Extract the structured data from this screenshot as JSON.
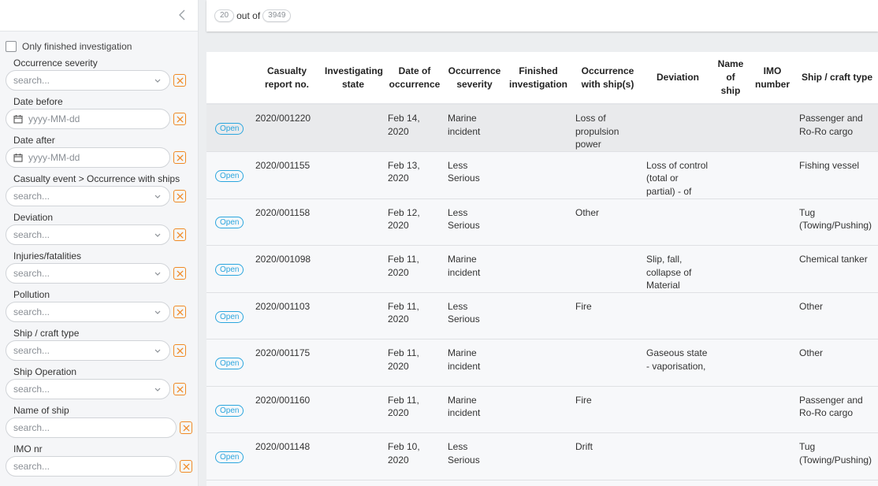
{
  "sidebar": {
    "collapse_icon": "chevron-left-icon",
    "only_finished_label": "Only finished investigation",
    "only_finished_checked": false,
    "filters": [
      {
        "label": "Occurrence severity",
        "type": "select",
        "placeholder": "search..."
      },
      {
        "label": "Date before",
        "type": "date",
        "placeholder": "yyyy-MM-dd"
      },
      {
        "label": "Date after",
        "type": "date",
        "placeholder": "yyyy-MM-dd"
      },
      {
        "label": "Casualty event > Occurrence with ships",
        "type": "select",
        "placeholder": "search..."
      },
      {
        "label": "Deviation",
        "type": "select",
        "placeholder": "search..."
      },
      {
        "label": "Injuries/fatalities",
        "type": "select",
        "placeholder": "search..."
      },
      {
        "label": "Pollution",
        "type": "select",
        "placeholder": "search..."
      },
      {
        "label": "Ship / craft type",
        "type": "select",
        "placeholder": "search..."
      },
      {
        "label": "Ship Operation",
        "type": "select",
        "placeholder": "search..."
      },
      {
        "label": "Name of ship",
        "type": "text",
        "placeholder": "search..."
      },
      {
        "label": "IMO nr",
        "type": "text",
        "placeholder": "search..."
      }
    ]
  },
  "topbar": {
    "shown_count": "20",
    "out_of_label": "out of",
    "total_count": "3949"
  },
  "table": {
    "columns": [
      "",
      "Casualty report no.",
      "Investigating state",
      "Date of occurrence",
      "Occurrence severity",
      "Finished investigation",
      "Occurrence with ship(s)",
      "Deviation",
      "Name of ship",
      "IMO number",
      "Ship / craft type"
    ],
    "rows": [
      {
        "status": "Open",
        "report_no": "2020/001220",
        "investigating_state": "",
        "date": "Feb 14, 2020",
        "severity": "Marine incident",
        "finished": "",
        "occurrence": "Loss of propulsion power",
        "deviation": "",
        "ship_name": "",
        "imo": "",
        "ship_type": "Passenger and Ro-Ro cargo",
        "selected": true
      },
      {
        "status": "Open",
        "report_no": "2020/001155",
        "investigating_state": "",
        "date": "Feb 13, 2020",
        "severity": "Less Serious",
        "finished": "",
        "occurrence": "",
        "deviation": "Loss of control (total or partial) - of",
        "ship_name": "",
        "imo": "",
        "ship_type": "Fishing vessel",
        "selected": false
      },
      {
        "status": "Open",
        "report_no": "2020/001158",
        "investigating_state": "",
        "date": "Feb 12, 2020",
        "severity": "Less Serious",
        "finished": "",
        "occurrence": "Other",
        "deviation": "",
        "ship_name": "",
        "imo": "",
        "ship_type": "Tug (Towing/Pushing)",
        "selected": false
      },
      {
        "status": "Open",
        "report_no": "2020/001098",
        "investigating_state": "",
        "date": "Feb 11, 2020",
        "severity": "Marine incident",
        "finished": "",
        "occurrence": "",
        "deviation": "Slip, fall, collapse of Material",
        "ship_name": "",
        "imo": "",
        "ship_type": "Chemical tanker",
        "selected": false
      },
      {
        "status": "Open",
        "report_no": "2020/001103",
        "investigating_state": "",
        "date": "Feb 11, 2020",
        "severity": "Less Serious",
        "finished": "",
        "occurrence": "Fire",
        "deviation": "",
        "ship_name": "",
        "imo": "",
        "ship_type": "Other",
        "selected": false
      },
      {
        "status": "Open",
        "report_no": "2020/001175",
        "investigating_state": "",
        "date": "Feb 11, 2020",
        "severity": "Marine incident",
        "finished": "",
        "occurrence": "",
        "deviation": "Gaseous state - vaporisation,",
        "ship_name": "",
        "imo": "",
        "ship_type": "Other",
        "selected": false
      },
      {
        "status": "Open",
        "report_no": "2020/001160",
        "investigating_state": "",
        "date": "Feb 11, 2020",
        "severity": "Marine incident",
        "finished": "",
        "occurrence": "Fire",
        "deviation": "",
        "ship_name": "",
        "imo": "",
        "ship_type": "Passenger and Ro-Ro cargo",
        "selected": false
      },
      {
        "status": "Open",
        "report_no": "2020/001148",
        "investigating_state": "",
        "date": "Feb 10, 2020",
        "severity": "Less Serious",
        "finished": "",
        "occurrence": "Drift",
        "deviation": "",
        "ship_name": "",
        "imo": "",
        "ship_type": "Tug (Towing/Pushing)",
        "selected": false
      }
    ]
  },
  "colors": {
    "accent_orange": "#f08a24",
    "badge_blue": "#2ba6de",
    "selected_row": "#e9eaec"
  }
}
